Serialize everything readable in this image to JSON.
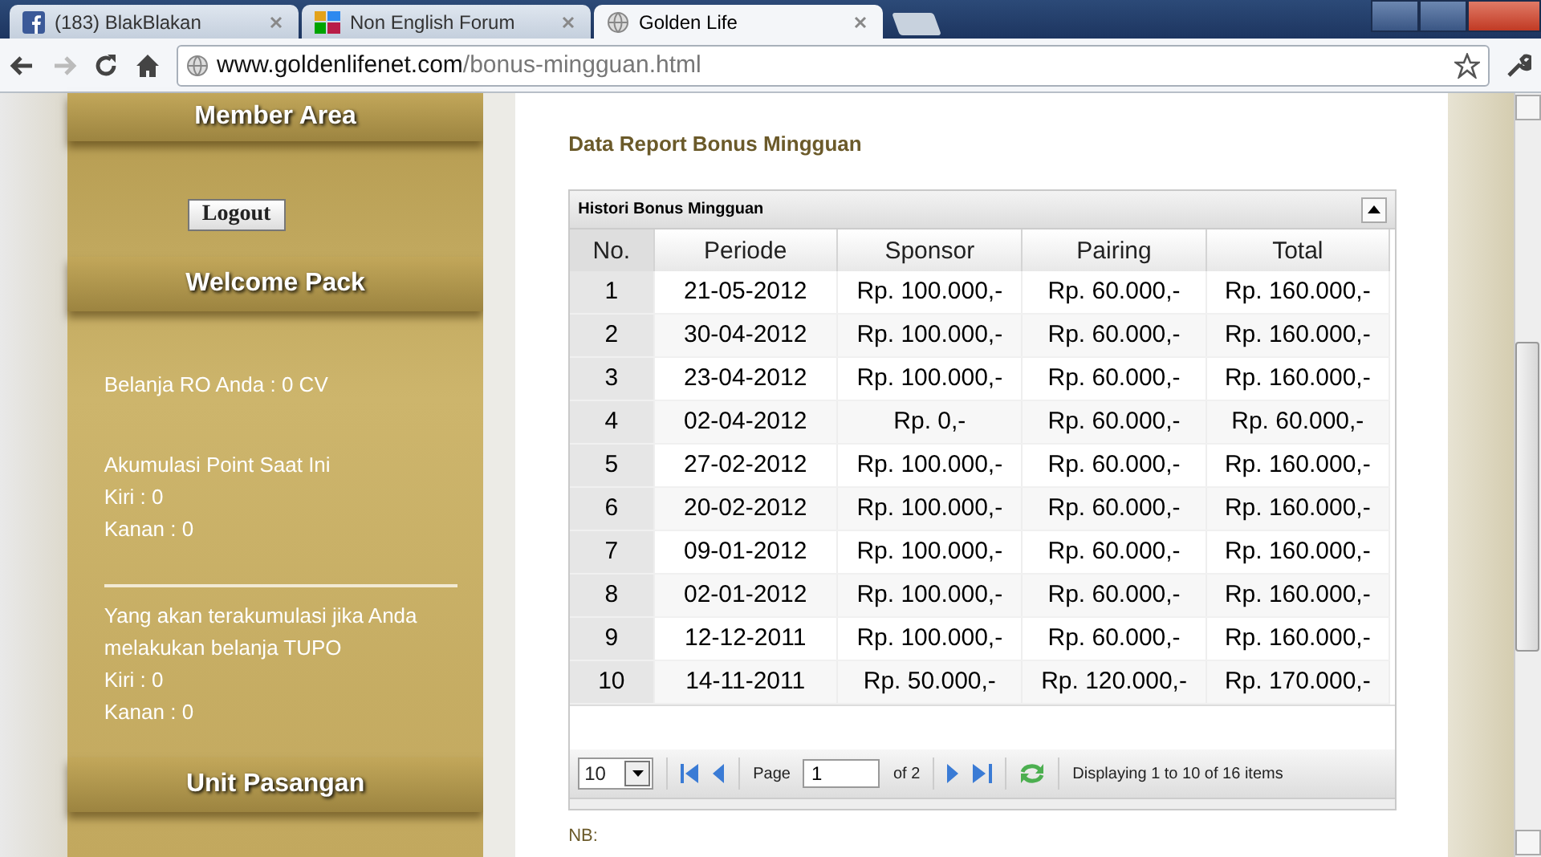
{
  "browser": {
    "tabs": [
      {
        "title": "(183) BlakBlakan",
        "selected": false
      },
      {
        "title": "Non English Forum",
        "selected": false
      },
      {
        "title": "Golden Life",
        "selected": true
      }
    ],
    "url_host": "www.goldenlifenet.com",
    "url_path": "/bonus-mingguan.html"
  },
  "sidebar": {
    "sections": [
      {
        "heading": "Member Area",
        "kind": "button",
        "button": "Logout"
      },
      {
        "heading": "Welcome Pack",
        "kind": "text",
        "groups": [
          [
            "Belanja RO Anda : 0 CV"
          ],
          [
            "Akumulasi Point Saat Ini",
            "Kiri : 0",
            "Kanan : 0"
          ],
          [
            "Yang akan terakumulasi jika Anda melakukan belanja TUPO",
            "Kiri : 0",
            "Kanan : 0"
          ]
        ]
      },
      {
        "heading": "Unit Pasangan",
        "kind": "empty"
      }
    ]
  },
  "content": {
    "title": "Data Report Bonus Mingguan",
    "grid": {
      "title": "Histori Bonus Mingguan",
      "columns": [
        "No.",
        "Periode",
        "Sponsor",
        "Pairing",
        "Total"
      ],
      "rows": [
        [
          "1",
          "21-05-2012",
          "Rp. 100.000,-",
          "Rp. 60.000,-",
          "Rp. 160.000,-"
        ],
        [
          "2",
          "30-04-2012",
          "Rp. 100.000,-",
          "Rp. 60.000,-",
          "Rp. 160.000,-"
        ],
        [
          "3",
          "23-04-2012",
          "Rp. 100.000,-",
          "Rp. 60.000,-",
          "Rp. 160.000,-"
        ],
        [
          "4",
          "02-04-2012",
          "Rp. 0,-",
          "Rp. 60.000,-",
          "Rp. 60.000,-"
        ],
        [
          "5",
          "27-02-2012",
          "Rp. 100.000,-",
          "Rp. 60.000,-",
          "Rp. 160.000,-"
        ],
        [
          "6",
          "20-02-2012",
          "Rp. 100.000,-",
          "Rp. 60.000,-",
          "Rp. 160.000,-"
        ],
        [
          "7",
          "09-01-2012",
          "Rp. 100.000,-",
          "Rp. 60.000,-",
          "Rp. 160.000,-"
        ],
        [
          "8",
          "02-01-2012",
          "Rp. 100.000,-",
          "Rp. 60.000,-",
          "Rp. 160.000,-"
        ],
        [
          "9",
          "12-12-2011",
          "Rp. 100.000,-",
          "Rp. 60.000,-",
          "Rp. 160.000,-"
        ],
        [
          "10",
          "14-11-2011",
          "Rp. 50.000,-",
          "Rp. 120.000,-",
          "Rp. 170.000,-"
        ]
      ],
      "pager": {
        "page_size": "10",
        "page_label": "Page",
        "page": "1",
        "of": "of 2",
        "status": "Displaying 1 to 10 of 16 items"
      }
    },
    "note": "NB:"
  }
}
